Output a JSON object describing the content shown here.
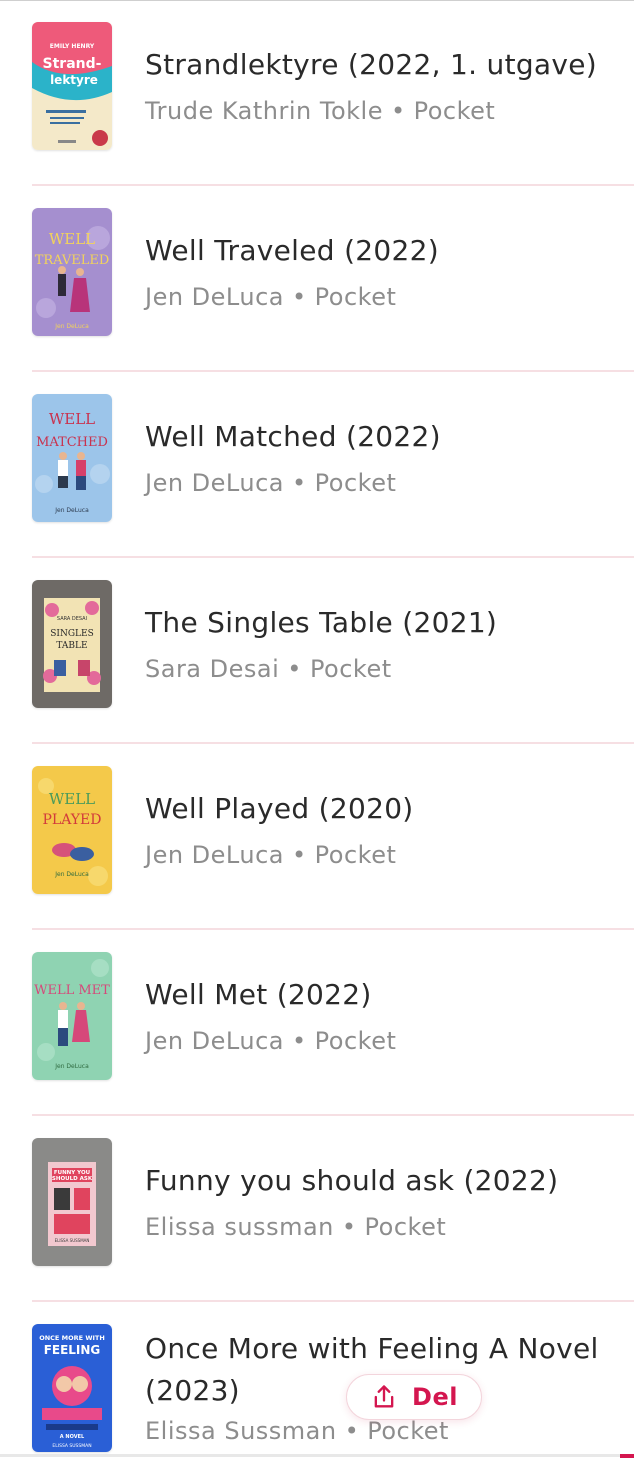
{
  "books": [
    {
      "title": "Strandlektyre (2022, 1. utgave)",
      "author": "Trude Kathrin Tokle",
      "format": "Pocket",
      "cover": {
        "main": "#f4e9c9",
        "accent": "#2bb3c9",
        "text": "Strand-\nlektyre",
        "author_on_cover": "EMILY HENRY",
        "top_color": "#ee5a7a"
      }
    },
    {
      "title": "Well Traveled (2022)",
      "author": "Jen DeLuca",
      "format": "Pocket",
      "cover": {
        "main": "#a58fcf",
        "accent": "#f2d35b",
        "text": "WELL TRAVELED",
        "author_on_cover": "Jen DeLuca"
      }
    },
    {
      "title": "Well Matched (2022)",
      "author": "Jen DeLuca",
      "format": "Pocket",
      "cover": {
        "main": "#9cc5ea",
        "accent": "#c9324e",
        "text": "WELL MATCHED",
        "author_on_cover": "Jen DeLuca"
      }
    },
    {
      "title": "The Singles Table (2021)",
      "author": "Sara Desai",
      "format": "Pocket",
      "cover": {
        "main": "#6e6a66",
        "accent": "#f2d97a",
        "text": "SINGLES TABLE",
        "author_on_cover": "SARA DESAI"
      }
    },
    {
      "title": "Well Played (2020)",
      "author": "Jen DeLuca",
      "format": "Pocket",
      "cover": {
        "main": "#f4c94a",
        "accent": "#d23b3b",
        "text": "WELL PLAYED",
        "author_on_cover": "Jen DeLuca"
      }
    },
    {
      "title": "Well Met (2022)",
      "author": "Jen DeLuca",
      "format": "Pocket",
      "cover": {
        "main": "#8fd3b2",
        "accent": "#d6487a",
        "text": "WELL MET",
        "author_on_cover": "Jen DeLuca"
      }
    },
    {
      "title": "Funny you should ask (2022)",
      "author": "Elissa sussman",
      "format": "Pocket",
      "cover": {
        "main": "#8a8a88",
        "accent": "#e0445e",
        "text": "FUNNY YOU SHOULD ASK",
        "author_on_cover": "ELISSA SUSSMAN"
      }
    },
    {
      "title": "Once More with Feeling A Novel (2023)",
      "author": "Elissa Sussman",
      "format": "Pocket",
      "cover": {
        "main": "#2a5fd6",
        "accent": "#e84a8a",
        "text": "ONCE MORE WITH FEELING",
        "author_on_cover": "ELISSA SUSSMAN"
      }
    }
  ],
  "share_button": {
    "label": "Del",
    "icon": "share-upload-icon"
  },
  "colors": {
    "accent": "#d4164f",
    "divider": "#f6dfe3",
    "meta_text": "#8d8d8d"
  }
}
